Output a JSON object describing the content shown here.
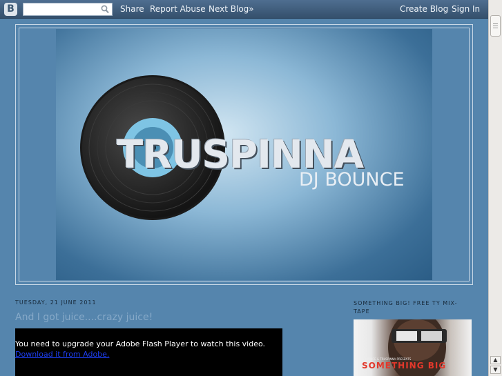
{
  "navbar": {
    "logo": "B",
    "search_placeholder": "",
    "share": "Share",
    "report_abuse": "Report Abuse",
    "next_blog": "Next Blog»",
    "create_blog": "Create Blog",
    "sign_in": "Sign In"
  },
  "header": {
    "title": "TRUSPINNA",
    "subtitle": "DJ BOUNCE"
  },
  "post": {
    "date": "TUESDAY, 21 JUNE 2011",
    "title": "And I got juice....crazy juice!",
    "video_message": "You need to upgrade your Adobe Flash Player to watch this video.",
    "video_link": "Download it from Adobe."
  },
  "sidebar": {
    "widget_title": "SOMETHING BIG! FREE TY MIX-TAPE",
    "image_text": "SOMETHING BIG",
    "image_small_text": "DJ BOUNCE & TRUSPINNA PRESENTS"
  },
  "colors": {
    "background": "#5585ad",
    "navbar": "#3d5873",
    "post_title": "#86a9c8",
    "link": "#1d3ef0"
  }
}
